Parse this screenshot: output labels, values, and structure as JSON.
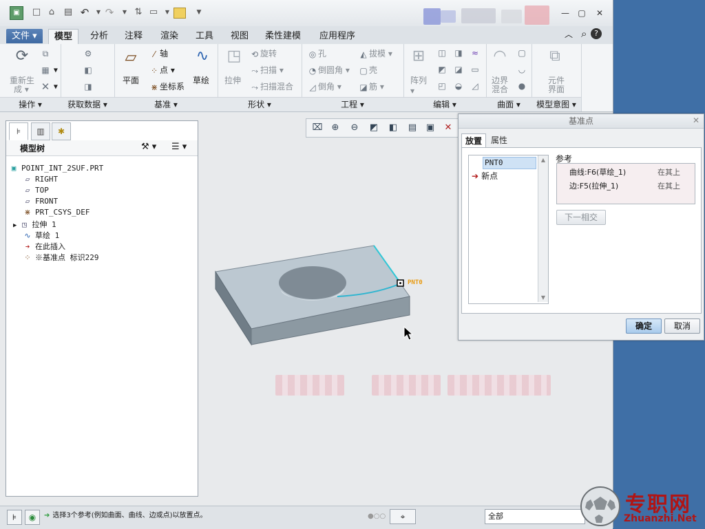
{
  "title_bar": {
    "close_glyph": "✕",
    "maximize_glyph": "▢",
    "minimize_glyph": "—"
  },
  "tabs": [
    "文件",
    "模型",
    "分析",
    "注释",
    "渲染",
    "工具",
    "视图",
    "柔性建模",
    "应用程序"
  ],
  "ribbon": {
    "operations": {
      "label": "操作",
      "regen": "重新生",
      "regen2": "成"
    },
    "get_data": {
      "label": "获取数据"
    },
    "datum": {
      "label": "基准",
      "plane": "平面",
      "axis": "轴",
      "point": "点",
      "csys": "坐标系",
      "sketch": "草绘"
    },
    "shapes": {
      "label": "形状",
      "extrude": "拉伸",
      "revolve": "旋转",
      "sweep": "扫描",
      "swept_blend": "扫描混合"
    },
    "engineering": {
      "label": "工程",
      "hole": "孔",
      "round": "倒圆角",
      "chamfer": "倒角",
      "draft": "拔模",
      "shell": "壳",
      "rib": "筋"
    },
    "editing": {
      "label": "编辑",
      "pattern": "阵列"
    },
    "surfaces": {
      "label": "曲面",
      "boundary_blend": "边界",
      "boundary_blend2": "混合"
    },
    "model_intent": {
      "label": "模型意图",
      "component_interface": "元件",
      "component_interface2": "界面"
    }
  },
  "model_tree": {
    "title": "模型树",
    "items": [
      {
        "label": "POINT_INT_2SUF.PRT",
        "icon": "part-icon"
      },
      {
        "label": "RIGHT",
        "icon": "datum-plane-icon"
      },
      {
        "label": "TOP",
        "icon": "datum-plane-icon"
      },
      {
        "label": "FRONT",
        "icon": "datum-plane-icon"
      },
      {
        "label": "PRT_CSYS_DEF",
        "icon": "csys-icon"
      },
      {
        "label": "拉伸 1",
        "icon": "extrude-icon"
      },
      {
        "label": "草绘 1",
        "icon": "sketch-icon"
      },
      {
        "label": "在此插入",
        "icon": "insert-arrow-icon"
      },
      {
        "label": "※基准点 标识229",
        "icon": "datum-point-icon"
      }
    ]
  },
  "graphics": {
    "point_label": "PNT0"
  },
  "dialog": {
    "title": "基准点",
    "tabs": [
      "放置",
      "属性"
    ],
    "points": [
      "PNT0",
      "新点"
    ],
    "references_label": "参考",
    "references": [
      {
        "ref": "曲线:F6(草绘_1)",
        "constraint": "在其上"
      },
      {
        "ref": "边:F5(拉伸_1)",
        "constraint": "在其上"
      }
    ],
    "next_intersection": "下一相交",
    "ok": "确定",
    "cancel": "取消"
  },
  "status": {
    "message": "选择3个参考(例如曲面、曲线、边或点)以放置点。",
    "filter": "全部"
  },
  "logo": {
    "cn": "专职网",
    "en": "Zhuanzhi.Net"
  }
}
